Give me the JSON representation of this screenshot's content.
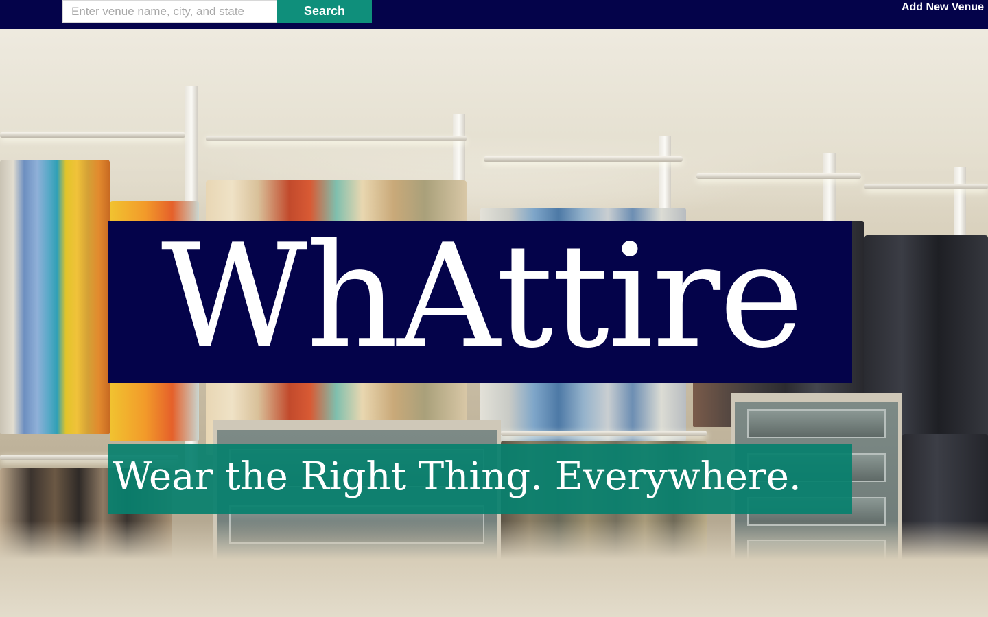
{
  "navbar": {
    "search": {
      "placeholder": "Enter venue name, city, and state",
      "value": ""
    },
    "search_button_label": "Search",
    "add_venue_label": "Add New Venue"
  },
  "hero": {
    "background_scene": "walk-in closet with hanging clothes and drawers",
    "logo_text": "WhAttire",
    "tagline": "Wear the Right Thing. Everywhere."
  },
  "colors": {
    "navbar_bg": "#04034a",
    "accent_teal": "#0f8f7b",
    "logo_box_bg": "#04034a",
    "tagline_box_bg": "#08806e",
    "text_light": "#ffffff"
  }
}
